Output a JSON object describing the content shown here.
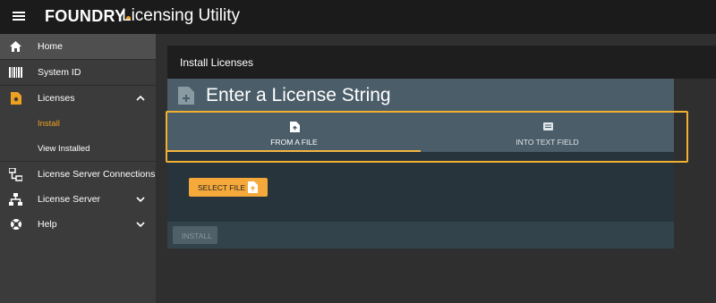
{
  "header": {
    "brand": "FOUNDRY",
    "title": "Licensing Utility",
    "menu_icon": "hamburger-menu-icon"
  },
  "sidebar": {
    "items": [
      {
        "label": "Home",
        "icon": "home-icon"
      },
      {
        "label": "System ID",
        "icon": "barcode-icon"
      },
      {
        "label": "Licenses",
        "icon": "license-file-icon",
        "expanded": true
      },
      {
        "label": "Install"
      },
      {
        "label": "View Installed"
      },
      {
        "label": "License Server Connections",
        "icon": "network-connection-icon"
      },
      {
        "label": "License Server",
        "icon": "server-tree-icon"
      },
      {
        "label": "Help",
        "icon": "help-lifebuoy-icon"
      }
    ]
  },
  "panel": {
    "title": "Install Licenses"
  },
  "card": {
    "title": "Enter a License String",
    "tabs": [
      {
        "label": "FROM A FILE",
        "icon": "file-upload-icon",
        "active": true
      },
      {
        "label": "INTO TEXT FIELD",
        "icon": "text-field-icon",
        "active": false
      }
    ],
    "select_file_label": "SELECT FILE",
    "install_label": "INSTALL"
  },
  "colors": {
    "accent": "#f0a020",
    "highlight": "#f0b030",
    "card_header": "#4a5d68",
    "card_body": "#27343b"
  }
}
